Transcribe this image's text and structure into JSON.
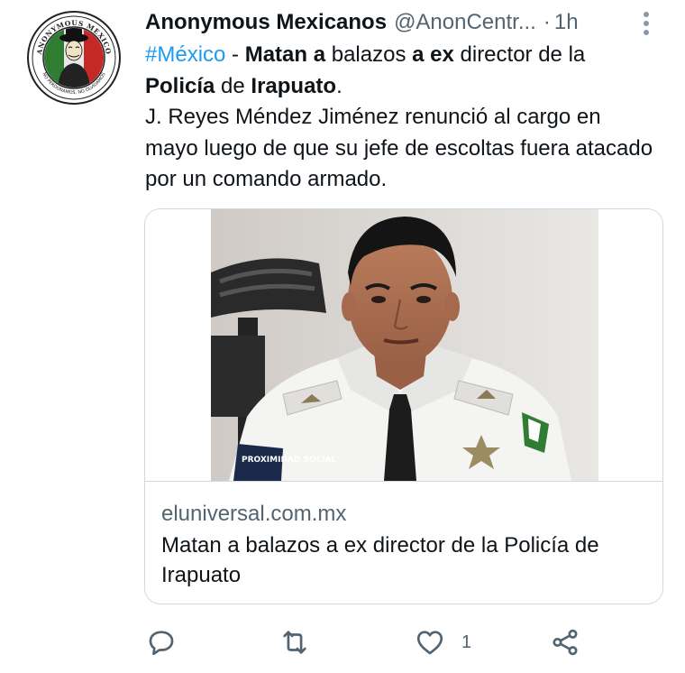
{
  "tweet": {
    "display_name": "Anonymous Mexicanos",
    "handle": "@AnonCentr...",
    "separator": "·",
    "time": "1h",
    "text": {
      "hashtag": "#México",
      "dash": " - ",
      "b1": "Matan a",
      "t1": " balazos ",
      "b2": "a ex",
      "t2": " director de la ",
      "b3": "Policía",
      "t3": " de ",
      "b4": "Irapuato",
      "t4": ".",
      "line2": "J. Reyes Méndez Jiménez renunció al cargo en mayo luego de que su jefe de escoltas fuera atacado por un comando armado."
    },
    "avatar": {
      "ring_top_text": "ANONYMOUS MEXICO",
      "ring_bottom_text": "NO PERDONAMOS, NO OLVIDAMOS",
      "flag_colors": [
        "#2e7d32",
        "#ffffff",
        "#c62828"
      ]
    }
  },
  "card": {
    "domain": "eluniversal.com.mx",
    "title": "Matan a balazos a ex director de la Policía de Irapuato",
    "badge_text": "PROXIMIDAD SOCIAL"
  },
  "actions": {
    "reply_icon": "reply-icon",
    "retweet_icon": "retweet-icon",
    "like_icon": "heart-icon",
    "like_count": "1",
    "share_icon": "share-icon"
  },
  "colors": {
    "accent": "#1d9bf0",
    "secondary_text": "#536471",
    "border": "#cfd9de"
  }
}
